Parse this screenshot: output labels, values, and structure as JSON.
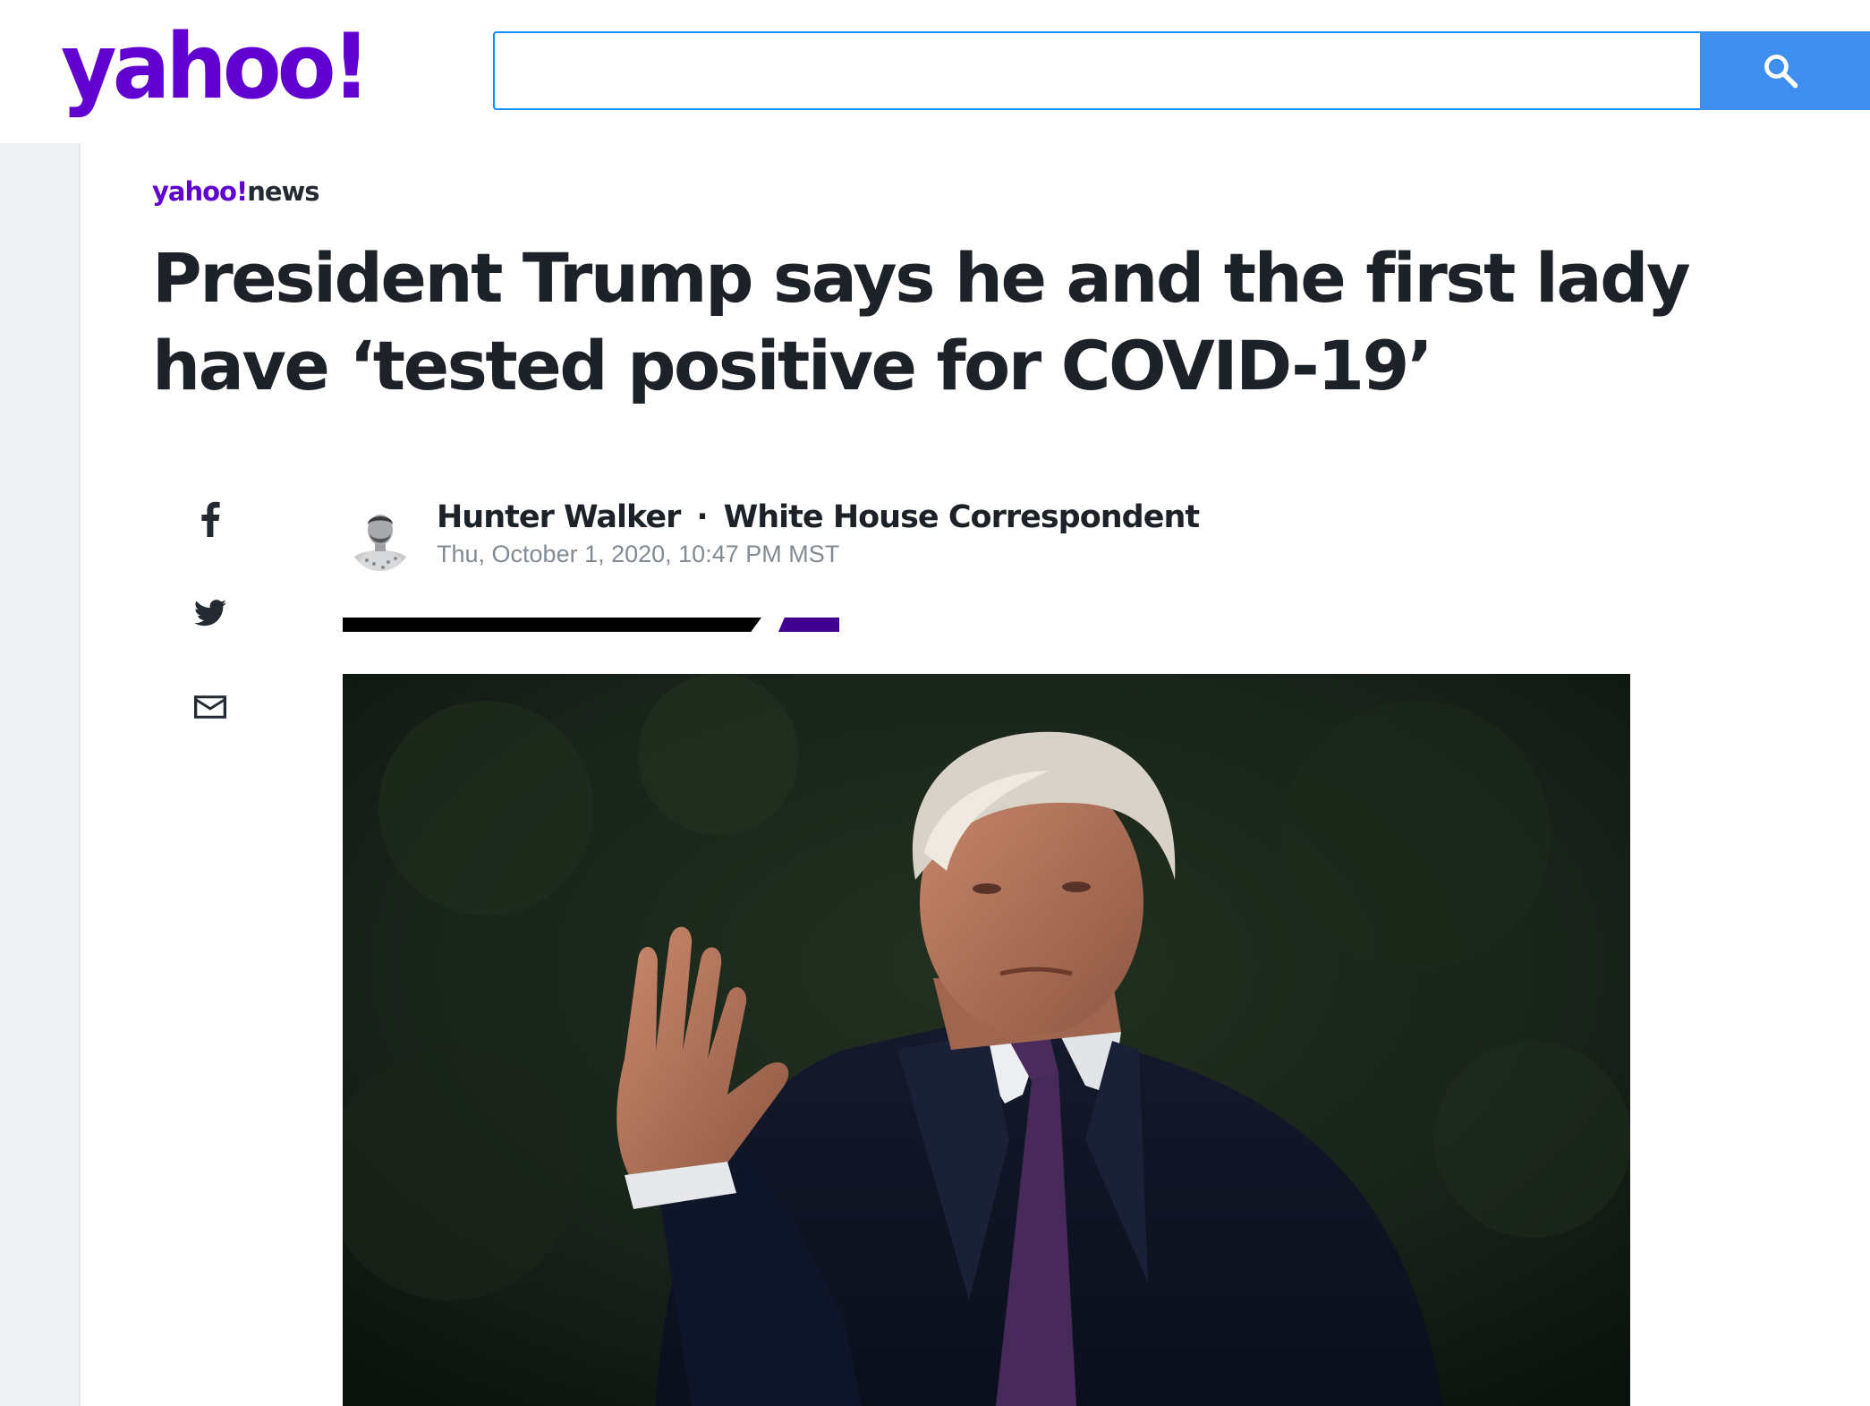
{
  "header": {
    "logo_text": "yahoo!",
    "search": {
      "value": "",
      "placeholder": ""
    },
    "search_button_icon": "search-icon"
  },
  "article": {
    "brand": {
      "yahoo": "yahoo!",
      "section": "news"
    },
    "headline": "President Trump says he and the first lady have ‘tested positive for COVID-19’",
    "author": {
      "name": "Hunter Walker",
      "separator": "·",
      "title": "White House Correspondent",
      "timestamp": "Thu, October 1, 2020, 10:47 PM MST"
    },
    "share_icons": [
      "facebook-icon",
      "twitter-icon",
      "mail-icon"
    ],
    "hero_image": "photo of man in dark coat and purple tie raising right hand, dark green background"
  },
  "colors": {
    "brand_purple": "#6001d2",
    "search_border": "#188fff",
    "search_button": "#3e8ef0",
    "headline": "#1d2228",
    "timestamp": "#828a93",
    "accent_rule": "#400090"
  }
}
